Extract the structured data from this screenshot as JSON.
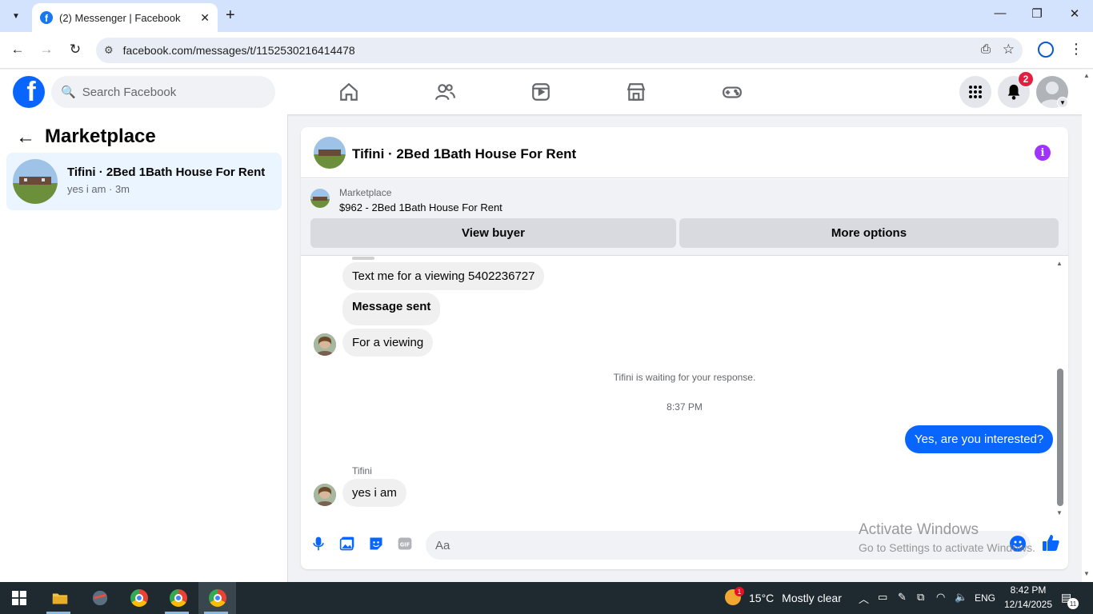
{
  "browser": {
    "tab_title": "(2) Messenger | Facebook",
    "url": "facebook.com/messages/t/1152530216414478"
  },
  "fb": {
    "search_placeholder": "Search Facebook",
    "notif_count": "2"
  },
  "left_panel": {
    "title": "Marketplace",
    "conversation": {
      "title": "Tifini · 2Bed 1Bath House For Rent",
      "subtitle": "yes i am · 3m"
    }
  },
  "chat": {
    "title": "Tifini · 2Bed 1Bath House For Rent",
    "listing_label": "Marketplace",
    "listing_title": "$962 - 2Bed 1Bath House For Rent",
    "view_buyer_label": "View buyer",
    "more_options_label": "More options",
    "messages": [
      {
        "text": "Text me for a viewing 5402236727"
      },
      {
        "text": "Message sent"
      },
      {
        "text": "For a viewing"
      }
    ],
    "waiting_note": "Tifini is waiting for your response.",
    "timestamp": "8:37 PM",
    "outgoing": "Yes, are you interested?",
    "sender_name": "Tifini",
    "last_incoming": "yes i am",
    "composer_placeholder": "Aa"
  },
  "watermark": {
    "title": "Activate Windows",
    "subtitle": "Go to Settings to activate Windows."
  },
  "taskbar": {
    "weather_temp": "15°C",
    "weather_desc": "Mostly clear",
    "weather_badge": "1",
    "language": "ENG",
    "time": "8:42 PM",
    "date": "12/14/2025",
    "notif_count": "11"
  },
  "colors": {
    "fb_blue": "#0866ff",
    "selected_convo": "#ebf5ff",
    "badge_red": "#e41e3f",
    "info_purple": "#a033ff"
  }
}
